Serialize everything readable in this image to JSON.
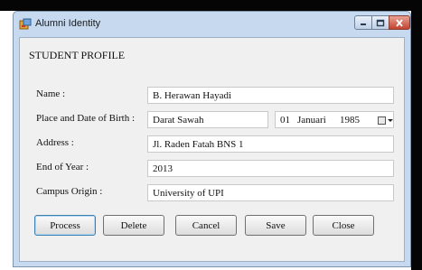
{
  "window": {
    "title": "Alumni Identity",
    "icon": "app-form-icon",
    "controls": [
      "minimize-icon",
      "maximize-icon",
      "close-icon"
    ]
  },
  "form": {
    "section_title": "STUDENT PROFILE",
    "fields": {
      "name": {
        "label": "Name :",
        "value": "B. Herawan Hayadi"
      },
      "birth": {
        "label": "Place and Date of Birth :",
        "place": "Darat Sawah",
        "day": "01",
        "month": "Januari",
        "year": "1985"
      },
      "address": {
        "label": "Address :",
        "value": "Jl. Raden Fatah BNS 1"
      },
      "end_year": {
        "label": "End of Year :",
        "value": "2013"
      },
      "campus": {
        "label": "Campus Origin :",
        "value": "University of UPI"
      }
    }
  },
  "buttons": {
    "process": "Process",
    "delete": "Delete",
    "cancel": "Cancel",
    "save": "Save",
    "close": "Close"
  }
}
